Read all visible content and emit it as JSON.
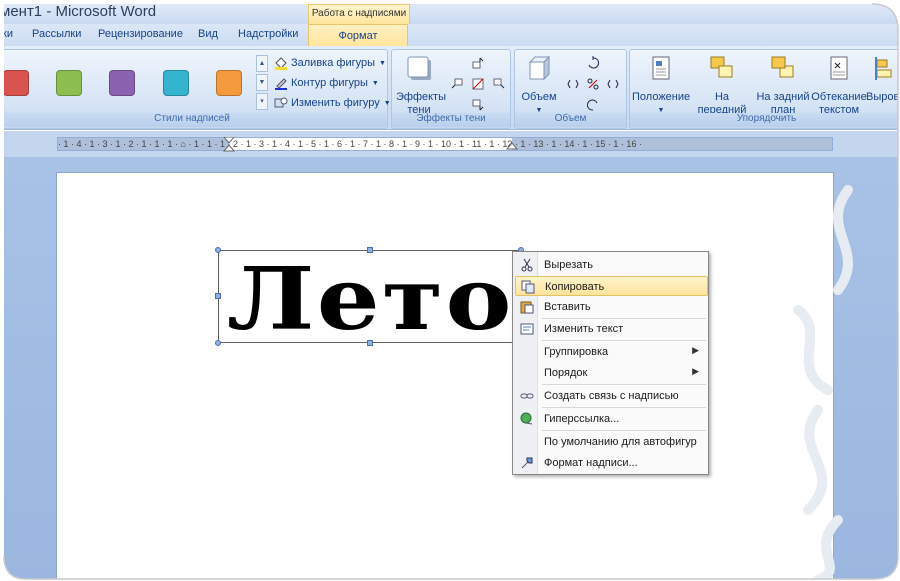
{
  "window": {
    "title": "мент1 - Microsoft Word",
    "context_tab_header": "Работа с надписями"
  },
  "tabs": [
    {
      "label": "ки"
    },
    {
      "label": "Рассылки"
    },
    {
      "label": "Рецензирование"
    },
    {
      "label": "Вид"
    },
    {
      "label": "Надстройки"
    },
    {
      "label": "Формат",
      "active": true
    }
  ],
  "ribbon": {
    "styles_group": {
      "label": "Стили надписей",
      "swatches": [
        "#d9534f",
        "#8cbf4f",
        "#8b62b0",
        "#35b4cf",
        "#f59a3c"
      ],
      "commands": [
        {
          "label": "Заливка фигуры",
          "icon": "paint-bucket-icon"
        },
        {
          "label": "Контур фигуры",
          "icon": "pencil-outline-icon"
        },
        {
          "label": "Изменить фигуру",
          "icon": "change-shape-icon"
        }
      ]
    },
    "shadow_group": {
      "label": "Эффекты тени",
      "button": "Эффекты\nтени"
    },
    "volume_group": {
      "label": "Объем",
      "button": "Объем"
    },
    "arrange_group": {
      "label": "Упорядочить",
      "buttons": [
        "Положение",
        "На передний\nплан",
        "На задний\nплан",
        "Обтекание\nтекстом",
        "Выровн"
      ]
    }
  },
  "ruler": {
    "text": "· 1 · 4 · 1 · 3 · 1 · 2 · 1 · 1 · 1 · ⌂ · 1 · 1 · 1 · 2 · 1 · 3 · 1 · 4 · 1 · 5 · 1 · 6 · 1 · 7 · 1 · 8 · 1 · 9 · 1 · 10 · 1 · 11 · 1 · 12 · 1 · 13 · 1 · 14 · 1 · 15 · 1 · 16 ·"
  },
  "document": {
    "textbox_text": "Лето-"
  },
  "context_menu": {
    "items": [
      {
        "label": "Вырезать",
        "icon": "scissors-icon"
      },
      {
        "label": "Копировать",
        "icon": "copy-icon",
        "highlighted": true
      },
      {
        "label": "Вставить",
        "icon": "paste-icon"
      },
      {
        "label": "Изменить текст",
        "icon": "edit-text-icon"
      },
      {
        "label": "Группировка",
        "submenu": true
      },
      {
        "label": "Порядок",
        "submenu": true
      },
      {
        "label": "Создать связь с надписью",
        "icon": "link-icon"
      },
      {
        "label": "Гиперссылка...",
        "icon": "hyperlink-globe-icon"
      },
      {
        "label": "По умолчанию для автофигур"
      },
      {
        "label": "Формат надписи...",
        "icon": "format-textbox-icon"
      }
    ]
  },
  "colors": {
    "ribbon_text": "#15428b",
    "highlight": "#fee39b",
    "workspace": "#a8c2e6"
  }
}
